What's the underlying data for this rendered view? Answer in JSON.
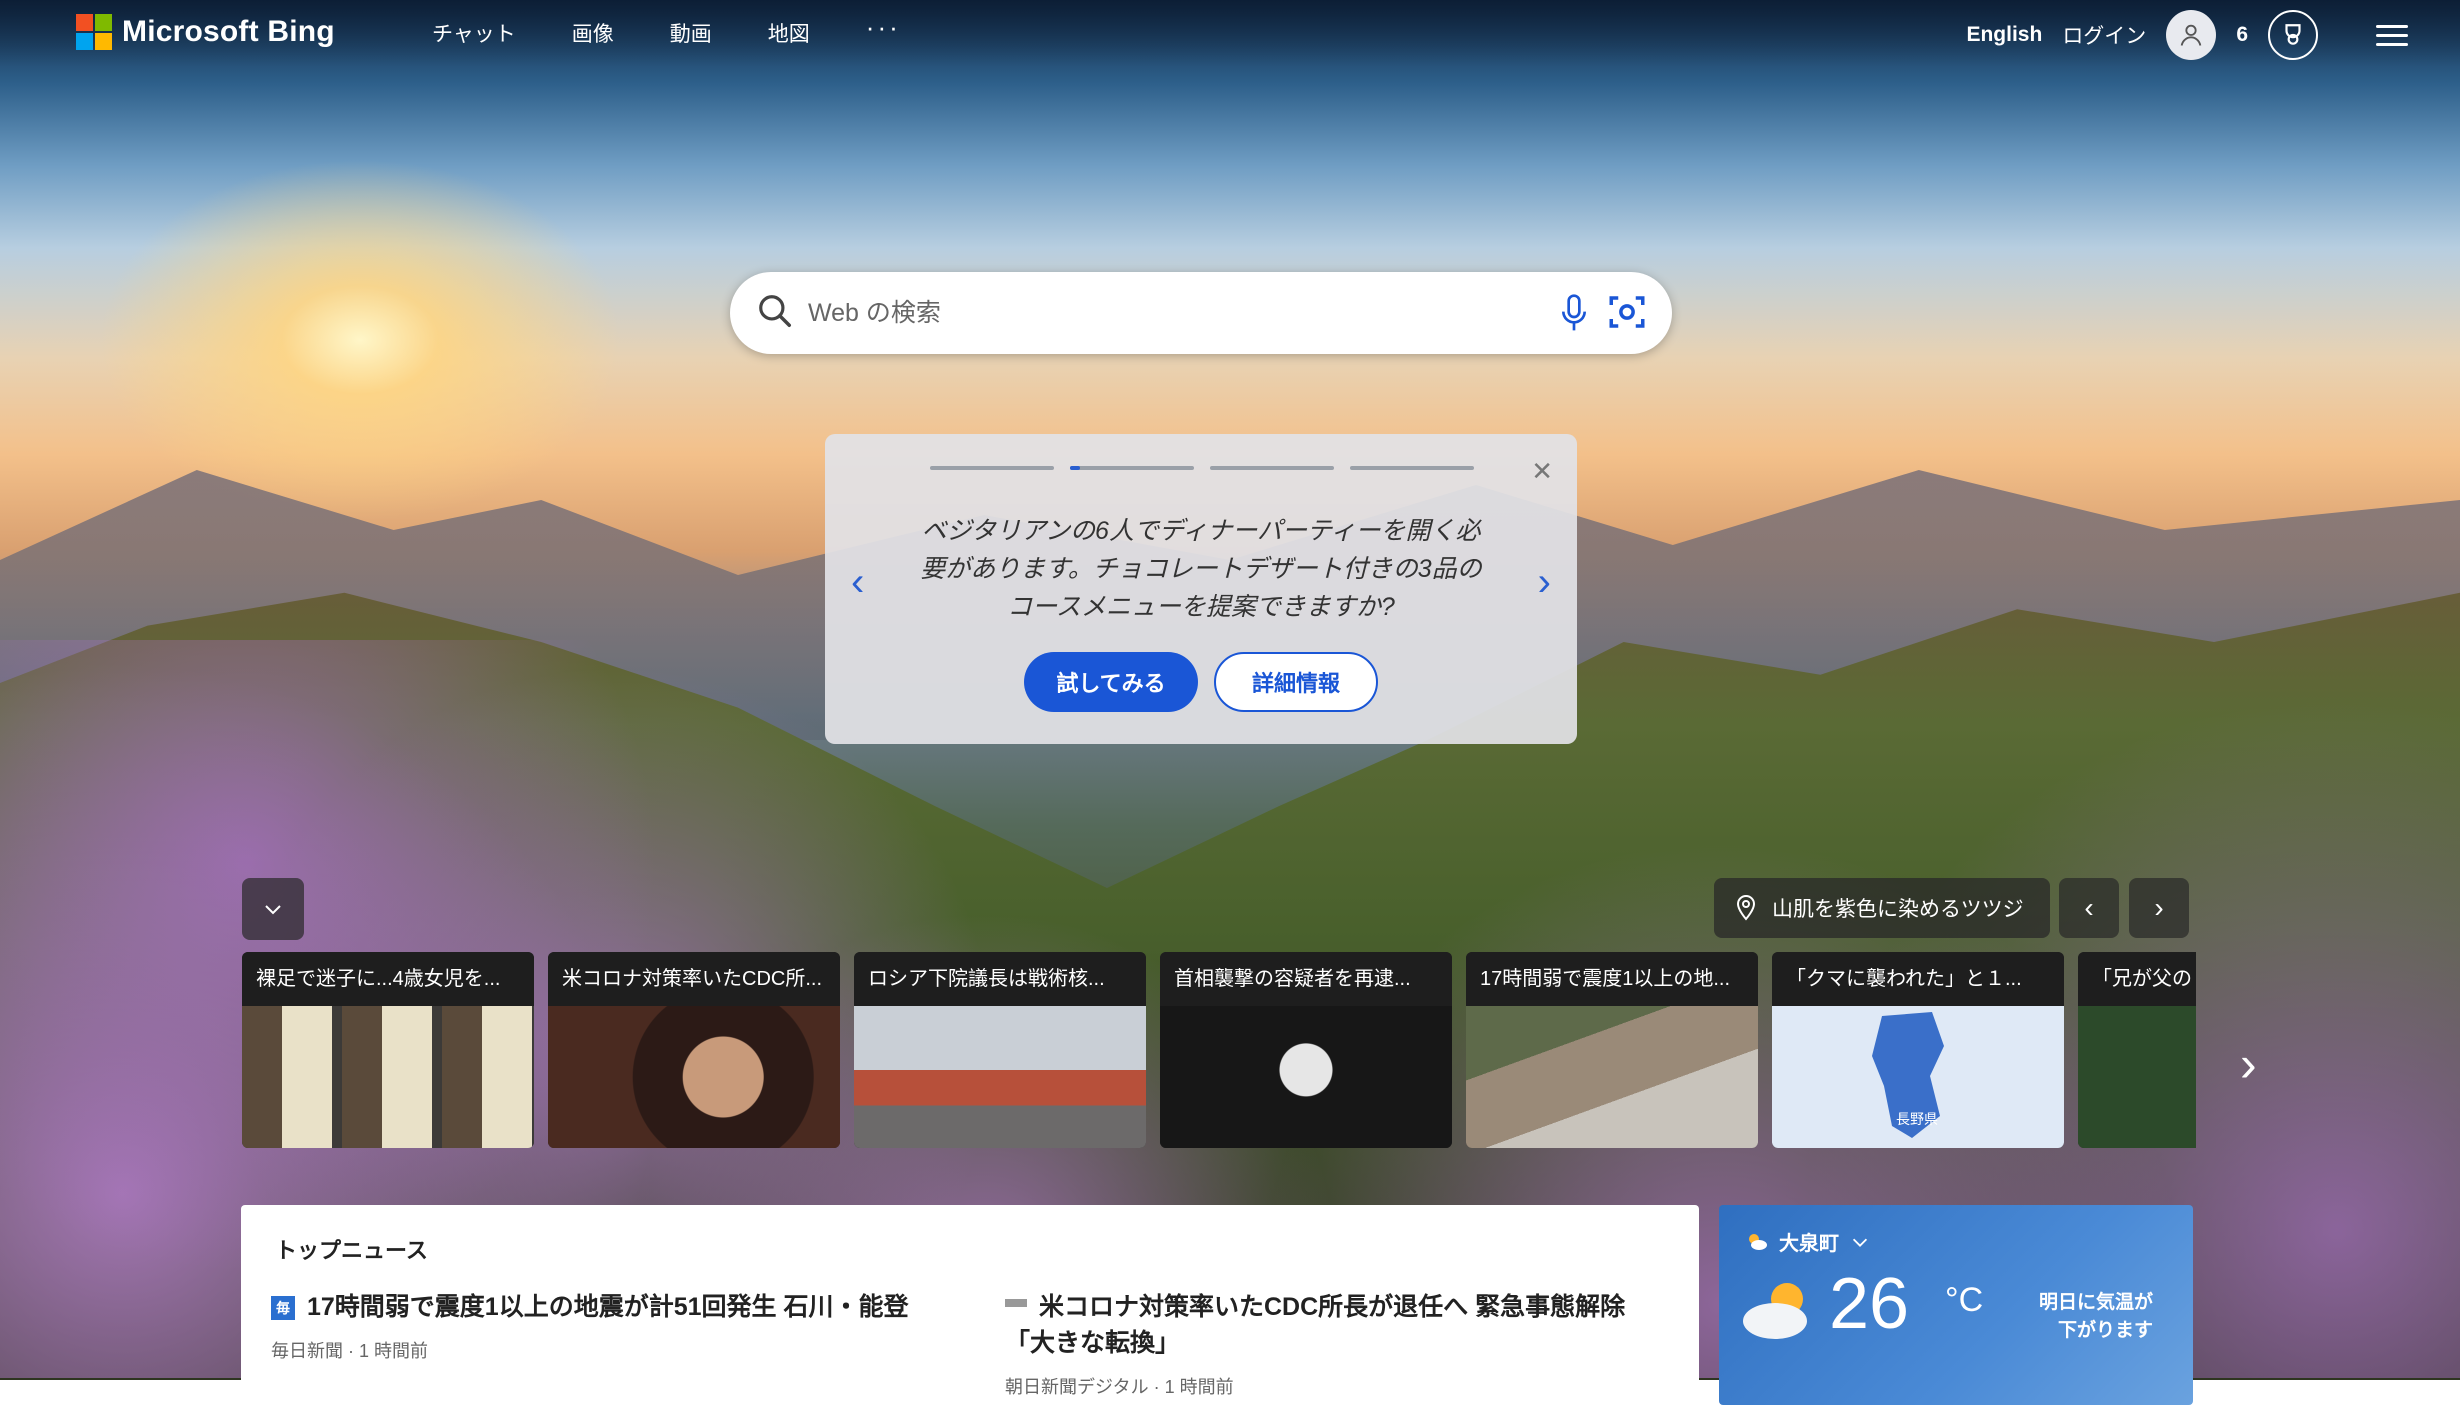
{
  "brand": {
    "name": "Microsoft Bing",
    "colors": [
      "#f25022",
      "#7fba00",
      "#00a4ef",
      "#ffb900"
    ]
  },
  "nav": {
    "items": [
      "チャット",
      "画像",
      "動画",
      "地図"
    ],
    "more": "···"
  },
  "header_right": {
    "language": "English",
    "login": "ログイン",
    "rewards_count": "6"
  },
  "search": {
    "placeholder": "Web の検索"
  },
  "promo": {
    "text": "ベジタリアンの6人でディナーパーティーを開く必要があります。チョコレートデザート付きの3品のコースメニューを提案できますか?",
    "try_button": "試してみる",
    "info_button": "詳細情報",
    "slide_index": 2,
    "slide_total": 4
  },
  "image_caption": {
    "text": "山肌を紫色に染めるツツジ"
  },
  "news_cards": [
    {
      "title": "裸足で迷子に...4歳女児を..."
    },
    {
      "title": "米コロナ対策率いたCDC所..."
    },
    {
      "title": "ロシア下院議長は戦術核..."
    },
    {
      "title": "首相襲撃の容疑者を再逮..."
    },
    {
      "title": "17時間弱で震度1以上の地..."
    },
    {
      "title": "「クマに襲われた」と１..."
    },
    {
      "title": "「兄が父の"
    }
  ],
  "map_label": "長野県",
  "top_news": {
    "heading": "トップニュース",
    "articles": [
      {
        "icon": "毎",
        "title": "17時間弱で震度1以上の地震が計51回発生 石川・能登",
        "meta": "毎日新聞 · 1 時間前"
      },
      {
        "icon": "",
        "title": "米コロナ対策率いたCDC所長が退任へ 緊急事態解除「大きな転換」",
        "meta": "朝日新聞デジタル · 1 時間前"
      }
    ]
  },
  "weather": {
    "location": "大泉町",
    "temperature": "26",
    "unit": "°C",
    "note_line1": "明日に気温が",
    "note_line2": "下がります"
  }
}
